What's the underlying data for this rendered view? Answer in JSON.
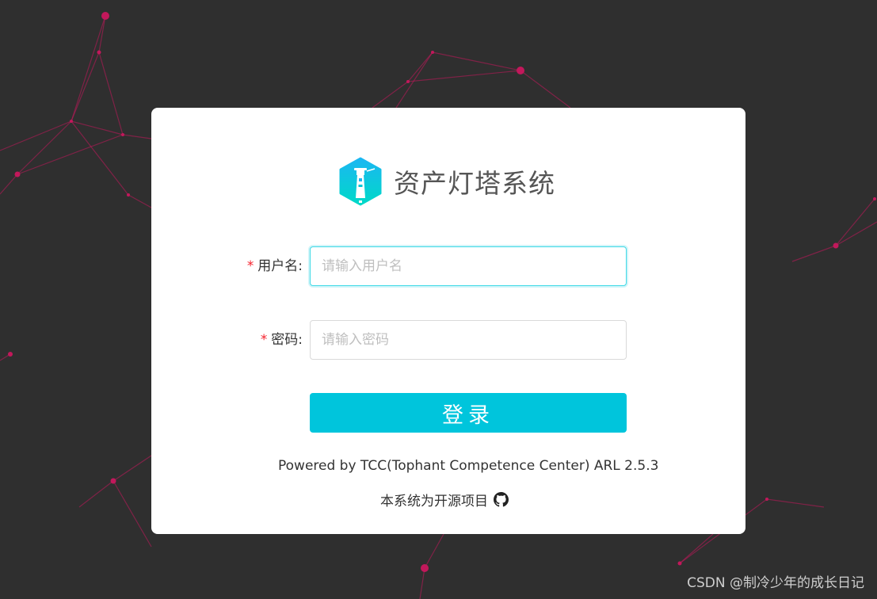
{
  "app": {
    "title": "资产灯塔系统"
  },
  "form": {
    "username": {
      "required_mark": "*",
      "label": "用户名:",
      "placeholder": "请输入用户名",
      "value": ""
    },
    "password": {
      "required_mark": "*",
      "label": "密码:",
      "placeholder": "请输入密码",
      "value": ""
    },
    "submit_label": "登录"
  },
  "footer": {
    "powered_by": "Powered by TCC(Tophant Competence Center) ARL 2.5.3",
    "open_source_text": "本系统为开源项目",
    "github_icon": "github-icon"
  },
  "watermark": "CSDN @制冷少年的成长日记",
  "colors": {
    "background": "#2f2f2f",
    "network_accent": "#c2185b",
    "primary_button": "#00c5dc",
    "focus_border": "#40d9e6",
    "required_star": "#f5222d"
  }
}
